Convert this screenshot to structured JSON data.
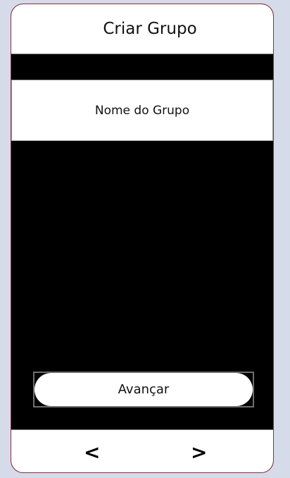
{
  "header": {
    "title": "Criar Grupo"
  },
  "form": {
    "group_name_placeholder": "Nome do Grupo"
  },
  "actions": {
    "next_label": "Avançar"
  },
  "footer": {
    "prev_label": "<",
    "next_label": ">"
  }
}
